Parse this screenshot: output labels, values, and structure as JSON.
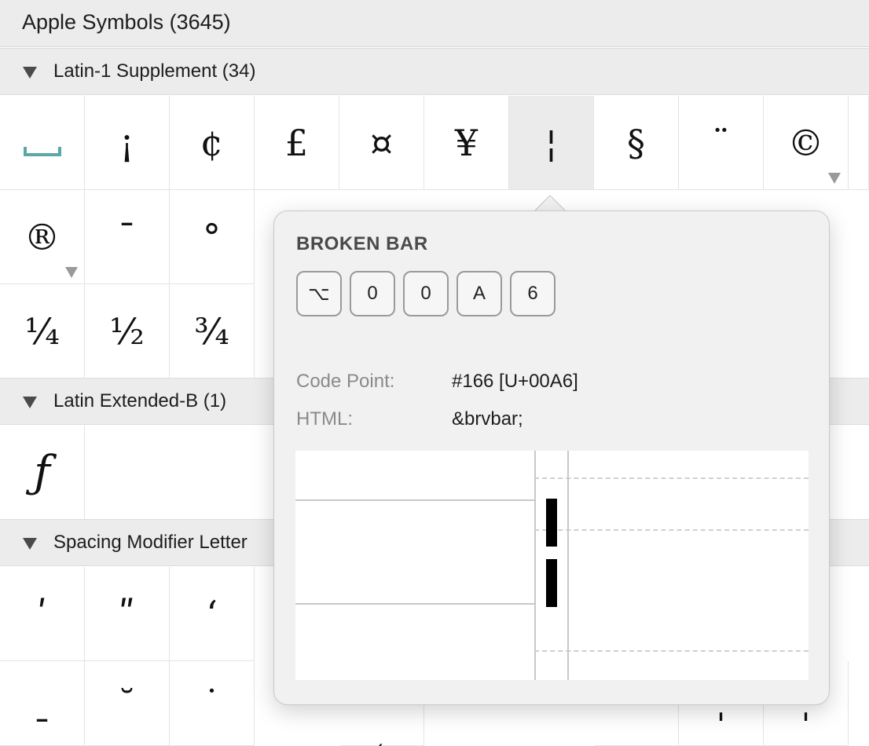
{
  "font_header": {
    "label": "Apple Symbols (3645)"
  },
  "sections": [
    {
      "label": "Latin-1 Supplement (34)"
    },
    {
      "label": "Latin Extended-B (1)"
    },
    {
      "label": "Spacing Modifier Letter"
    }
  ],
  "latin1": {
    "row1": [
      "␣",
      "¡",
      "¢",
      "£",
      "¤",
      "¥",
      "¦",
      "§",
      "¨",
      "©"
    ],
    "row2": [
      "®",
      "¯",
      "°"
    ],
    "row3": [
      "¼",
      "½",
      "¾"
    ]
  },
  "latin_ext_b": [
    "ƒ"
  ],
  "spacing_modifier": {
    "row1": [
      "ʹ",
      "ʺ",
      "ʻ"
    ],
    "row2": [
      "ˍ",
      "˘",
      "˙",
      "˛",
      "˝",
      "ˈ",
      "ˈ"
    ]
  },
  "popover": {
    "name": "BROKEN BAR",
    "keys": [
      "⌥",
      "0",
      "0",
      "A",
      "6"
    ],
    "code_point_label": "Code Point:",
    "code_point_value": "#166 [U+00A6]",
    "html_label": "HTML:",
    "html_value": "&brvbar;"
  },
  "colors": {
    "accent_space": "#5aa7a7",
    "selected_cell": "#ebebeb",
    "header_bg": "#ececec"
  },
  "icons": {
    "disclosure": "disclosure-triangle-icon",
    "variant": "variant-marker-icon"
  }
}
